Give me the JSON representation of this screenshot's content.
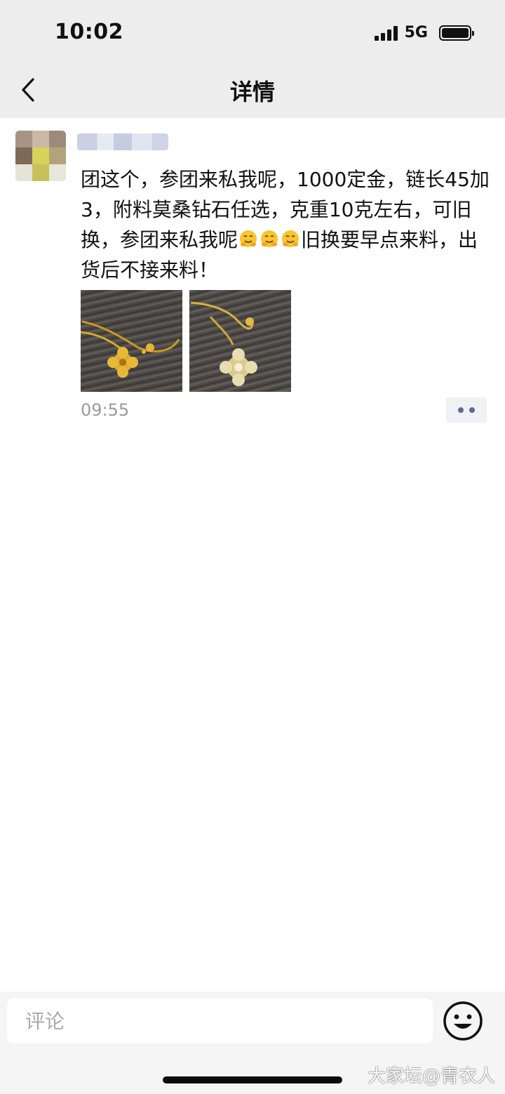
{
  "status_bar": {
    "time": "10:02",
    "network": "5G"
  },
  "header": {
    "title": "详情"
  },
  "post": {
    "text_before_emoji": "团这个，参团来私我呢，1000定金，链长45加3，附料莫桑钻石任选，克重10克左右，可旧换，参团来私我呢",
    "emoji_name": "hugging-face",
    "emoji_count": 3,
    "text_after_emoji": "旧换要早点来料，出货后不接来料！",
    "time": "09:55",
    "image_count": 2
  },
  "comment_bar": {
    "placeholder": "评论"
  },
  "watermark": "大家坛@青衣人",
  "colors": {
    "header_bg": "#ededed",
    "time_gray": "#9a9a9a",
    "more_dots": "#5b6b96",
    "bottom_bg": "#f5f5f5"
  }
}
